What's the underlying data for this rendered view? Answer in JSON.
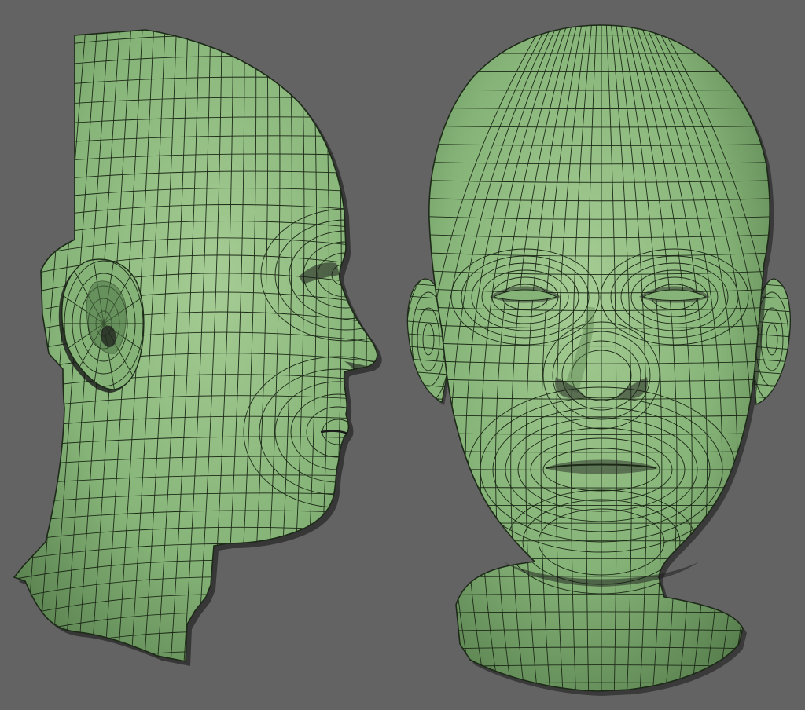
{
  "scene": {
    "background": "#636363",
    "mesh_fill": "#86b478",
    "mesh_fill_light": "#a5cc94",
    "mesh_fill_dark": "#4f7546",
    "wire_color": "#1d2a18",
    "shadow_color": "#1a1a1a"
  },
  "views": [
    {
      "name": "side-view",
      "object": "head-mesh",
      "orientation": "profile"
    },
    {
      "name": "front-view",
      "object": "head-mesh",
      "orientation": "front"
    }
  ]
}
